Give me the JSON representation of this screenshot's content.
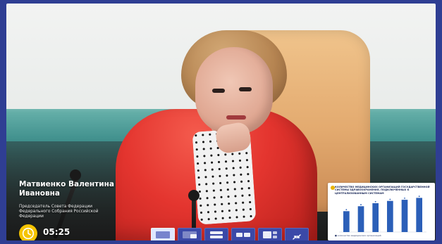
{
  "speaker": {
    "name": "Матвиенко Валентина Ивановна",
    "role": "Председатель Совета Федерации Федерального Собрания Российской Федерации"
  },
  "timer": {
    "value": "05:25"
  },
  "layout_buttons": [
    {
      "icon": "layout-full-icon",
      "active": true
    },
    {
      "icon": "layout-video-small-icon",
      "active": false
    },
    {
      "icon": "layout-split-horizontal-icon",
      "active": false
    },
    {
      "icon": "layout-split-vertical-icon",
      "active": false
    },
    {
      "icon": "layout-slide-focus-icon",
      "active": false
    },
    {
      "icon": "minimize-icon",
      "active": false
    }
  ],
  "slide": {
    "title": "КОЛИЧЕСТВО МЕДИЦИНСКИХ ОРГАНИЗАЦИЙ ГОСУДАРСТВЕННОЙ СИСТЕМЫ ЗДРАВООХРАНЕНИЯ, ПОДКЛЮЧЕННЫХ К ЦЕНТРАЛИЗОВАННЫМ СИСТЕМАМ",
    "legend": "■ количество медицинских организаций"
  },
  "chart_data": {
    "type": "bar",
    "categories": [
      "",
      "",
      "",
      "",
      "",
      ""
    ],
    "values": [
      55,
      68,
      76,
      82,
      85,
      90
    ],
    "ylim": [
      0,
      100
    ],
    "bar_color": "#2b5fb8"
  },
  "colors": {
    "frame_bg": "#2f3e93",
    "timer_icon": "#f5c400",
    "layout_button": "#3b49a8",
    "layout_button_active": "#dfe7ff"
  }
}
